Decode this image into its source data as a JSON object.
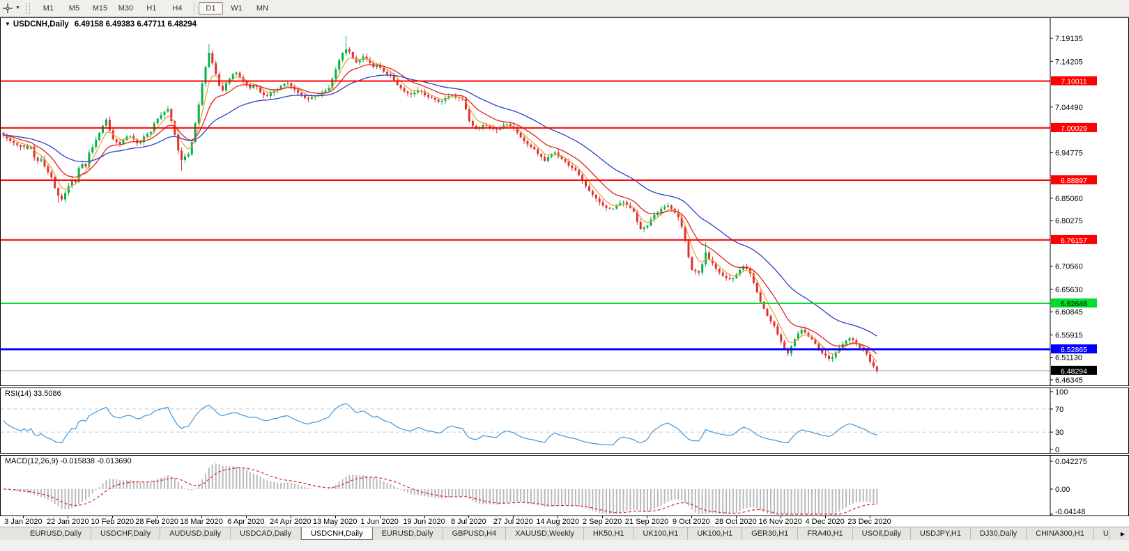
{
  "icons": {
    "dropdown_caret": "▼",
    "title_marker": "▼",
    "tab_scroll_right": "▶"
  },
  "toolbar": {
    "timeframes": [
      "M1",
      "M5",
      "M15",
      "M30",
      "H1",
      "H4",
      "D1",
      "W1",
      "MN"
    ],
    "active_timeframe": "D1"
  },
  "chart_header": {
    "symbol": "USDCNH,Daily",
    "ohlc": "6.49158 6.49383 6.47711 6.48294"
  },
  "indicators": {
    "rsi": {
      "label": "RSI(14)",
      "value": "33.5086"
    },
    "macd": {
      "label": "MACD(12,26,9)",
      "value": "-0.015838 -0.013690"
    }
  },
  "tabs": {
    "active_index": 4,
    "items": [
      "EURUSD,Daily",
      "USDCHF,Daily",
      "AUDUSD,Daily",
      "USDCAD,Daily",
      "USDCNH,Daily",
      "EURUSD,Daily",
      "GBPUSD,H4",
      "XAUUSD,Weekly",
      "HK50,H1",
      "UK100,H1",
      "UK100,H1",
      "GER30,H1",
      "FRA40,H1",
      "USOil,Daily",
      "USDJPY,H1",
      "DJ30,Daily",
      "CHINA300,H1",
      "U"
    ]
  },
  "chart_data": {
    "type": "candlestick",
    "title": "USDCNH,Daily",
    "x_labels": [
      "3 Jan 2020",
      "22 Jan 2020",
      "10 Feb 2020",
      "28 Feb 2020",
      "18 Mar 2020",
      "6 Apr 2020",
      "24 Apr 2020",
      "13 May 2020",
      "1 Jun 2020",
      "19 Jun 2020",
      "8 Jul 2020",
      "27 Jul 2020",
      "14 Aug 2020",
      "2 Sep 2020",
      "21 Sep 2020",
      "9 Oct 2020",
      "28 Oct 2020",
      "16 Nov 2020",
      "4 Dec 2020",
      "23 Dec 2020"
    ],
    "y_axis": {
      "top_price": 7.19135,
      "bottom_price": 6.46345,
      "tick_labels": [
        "7.19135",
        "7.14205",
        "7.04490",
        "6.94775",
        "6.85060",
        "6.80275",
        "6.70560",
        "6.65630",
        "6.60845",
        "6.55915",
        "6.51130",
        "6.46345"
      ]
    },
    "closes": [
      6.985,
      6.978,
      6.972,
      6.968,
      6.964,
      6.96,
      6.963,
      6.956,
      6.96,
      6.937,
      6.93,
      6.934,
      6.918,
      6.906,
      6.895,
      6.872,
      6.856,
      6.848,
      6.862,
      6.876,
      6.89,
      6.885,
      6.915,
      6.923,
      6.918,
      6.948,
      6.96,
      6.975,
      6.99,
      7.005,
      7.018,
      6.995,
      6.976,
      6.97,
      6.966,
      6.975,
      6.982,
      6.983,
      6.976,
      6.968,
      6.97,
      6.982,
      6.987,
      6.992,
      7.01,
      7.02,
      7.028,
      7.035,
      7.04,
      7.015,
      6.986,
      6.952,
      6.932,
      6.94,
      6.944,
      6.97,
      7.01,
      7.05,
      7.095,
      7.13,
      7.16,
      7.138,
      7.115,
      7.09,
      7.08,
      7.095,
      7.105,
      7.115,
      7.118,
      7.108,
      7.1,
      7.093,
      7.085,
      7.09,
      7.088,
      7.076,
      7.07,
      7.068,
      7.075,
      7.08,
      7.082,
      7.09,
      7.094,
      7.096,
      7.088,
      7.082,
      7.075,
      7.07,
      7.064,
      7.062,
      7.066,
      7.068,
      7.07,
      7.076,
      7.08,
      7.085,
      7.105,
      7.125,
      7.145,
      7.16,
      7.168,
      7.162,
      7.15,
      7.14,
      7.145,
      7.152,
      7.146,
      7.138,
      7.13,
      7.135,
      7.128,
      7.12,
      7.115,
      7.112,
      7.102,
      7.092,
      7.085,
      7.078,
      7.074,
      7.072,
      7.076,
      7.08,
      7.078,
      7.07,
      7.066,
      7.064,
      7.06,
      7.056,
      7.058,
      7.064,
      7.068,
      7.07,
      7.066,
      7.064,
      7.062,
      7.04,
      7.015,
      7.005,
      6.998,
      7.002,
      7.006,
      7.005,
      7.0,
      6.998,
      6.996,
      7.002,
      7.006,
      7.008,
      7.004,
      7.0,
      6.99,
      6.98,
      6.972,
      6.965,
      6.96,
      6.955,
      6.945,
      6.938,
      6.93,
      6.938,
      6.944,
      6.948,
      6.94,
      6.934,
      6.928,
      6.92,
      6.915,
      6.91,
      6.9,
      6.888,
      6.876,
      6.866,
      6.858,
      6.85,
      6.842,
      6.835,
      6.83,
      6.828,
      6.828,
      6.835,
      6.84,
      6.842,
      6.836,
      6.83,
      6.822,
      6.8,
      6.785,
      6.788,
      6.792,
      6.805,
      6.815,
      6.82,
      6.828,
      6.832,
      6.835,
      6.828,
      6.82,
      6.81,
      6.79,
      6.76,
      6.725,
      6.698,
      6.695,
      6.692,
      6.71,
      6.735,
      6.72,
      6.712,
      6.7,
      6.692,
      6.685,
      6.68,
      6.678,
      6.68,
      6.688,
      6.698,
      6.705,
      6.7,
      6.69,
      6.67,
      6.65,
      6.63,
      6.615,
      6.6,
      6.588,
      6.578,
      6.56,
      6.545,
      6.53,
      6.52,
      6.535,
      6.55,
      6.562,
      6.57,
      6.564,
      6.556,
      6.55,
      6.54,
      6.53,
      6.52,
      6.515,
      6.508,
      6.512,
      6.522,
      6.532,
      6.54,
      6.547,
      6.552,
      6.548,
      6.54,
      6.532,
      6.526,
      6.518,
      6.502,
      6.492,
      6.4829
    ],
    "wick_overrides": {
      "16": {
        "low": 6.841
      },
      "52": {
        "low": 6.909
      },
      "60": {
        "high": 7.1788
      },
      "100": {
        "high": 7.196
      },
      "205": {
        "high": 6.757
      },
      "255": {
        "high": 6.49383,
        "low": 6.47711
      }
    },
    "candle_colors": {
      "up": "#00b44a",
      "down": "#e03030"
    },
    "moving_averages": [
      {
        "period": 5,
        "color": "#eaa23e"
      },
      {
        "period": 13,
        "color": "#e02020"
      },
      {
        "period": 34,
        "color": "#2840cc"
      }
    ],
    "levels": [
      {
        "price": 7.10011,
        "label": "7.10011",
        "color": "#ff0000",
        "text_color": "#ffffff",
        "width": 2
      },
      {
        "price": 7.00029,
        "label": "7.00029",
        "color": "#ff0000",
        "text_color": "#ffffff",
        "width": 2
      },
      {
        "price": 6.88897,
        "label": "6.88897",
        "color": "#ff0000",
        "text_color": "#ffffff",
        "width": 2
      },
      {
        "price": 6.76157,
        "label": "6.76157",
        "color": "#ff0000",
        "text_color": "#ffffff",
        "width": 2
      },
      {
        "price": 6.62646,
        "label": "6.62646",
        "color": "#00dd2c",
        "text_color": "#000000",
        "width": 2
      },
      {
        "price": 6.52865,
        "label": "6.52865",
        "color": "#0000ff",
        "text_color": "#ffffff",
        "width": 3
      }
    ],
    "current_price": {
      "value": 6.48294,
      "label": "6.48294",
      "line_color": "#ababab",
      "bg": "#000000",
      "text_color": "#ffffff"
    },
    "rsi_panel": {
      "period": 14,
      "range": [
        0,
        100
      ],
      "levels": [
        70,
        30
      ],
      "tick_labels": [
        "100",
        "70",
        "30",
        "0"
      ],
      "line_color": "#3d96dc",
      "last_value": 33.5086
    },
    "macd_panel": {
      "fast": 12,
      "slow": 26,
      "signal": 9,
      "axis_max": 0.042275,
      "axis_min": -0.04148,
      "tick_labels": [
        "0.042275",
        "0.00",
        "-0.04148"
      ],
      "histogram_color": "#b9b9b9",
      "signal_color": "#e02020",
      "last_values": [
        -0.015838,
        -0.01369
      ]
    }
  }
}
